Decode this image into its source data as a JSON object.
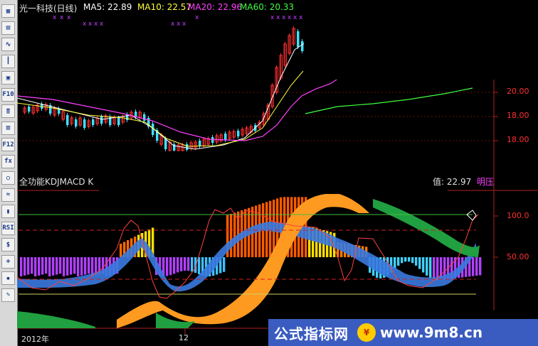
{
  "chart_data": {
    "type": "line",
    "price_panel": {
      "stock": "光一科技(日线)",
      "ma5_label": "MA5: 22.89",
      "ma10_label": "MA10: 22.57",
      "ma20_label": "MA20: 22.96",
      "ma60_label": "MA60: 20.33",
      "y_ticks": [
        "20.00",
        "18.00",
        "18.00"
      ],
      "colors": {
        "ma5": "#ffffff",
        "ma10": "#ffff40",
        "ma20": "#ff40ff",
        "ma60": "#40ff40",
        "up": "#ff3030",
        "down": "#40e0ff"
      }
    },
    "indicator_panel": {
      "name": "全功能KDJMACD K",
      "value_label": "值: 22.97",
      "tag": "明压",
      "y_ticks": [
        "100.0",
        "50.00"
      ]
    },
    "x_ticks": [
      "2012年",
      "12"
    ]
  },
  "toolbar": {
    "buttons": [
      {
        "icon": "grid-icon",
        "text": "▦"
      },
      {
        "icon": "table-icon",
        "text": "▤"
      },
      {
        "icon": "line-chart-icon",
        "text": "∿"
      },
      {
        "icon": "candle-icon",
        "text": "┃"
      },
      {
        "icon": "window-icon",
        "text": "▣"
      },
      {
        "icon": "f10-icon",
        "text": "F10"
      },
      {
        "icon": "stack-icon",
        "text": "≣"
      },
      {
        "icon": "page-icon",
        "text": "▥"
      },
      {
        "icon": "f12-icon",
        "text": "F12"
      },
      {
        "icon": "fx-icon",
        "text": "fx"
      },
      {
        "icon": "search-icon",
        "text": "○"
      },
      {
        "icon": "wave-icon",
        "text": "≈"
      },
      {
        "icon": "bars-icon",
        "text": "▮"
      },
      {
        "icon": "rsi-icon",
        "text": "RSI"
      },
      {
        "icon": "dollar-icon",
        "text": "$"
      },
      {
        "icon": "move-icon",
        "text": "✥"
      },
      {
        "icon": "book-icon",
        "text": "▪"
      },
      {
        "icon": "pencil-icon",
        "text": "✎"
      }
    ]
  },
  "watermark": {
    "left": "公式指标网",
    "logo": "¥",
    "right": "www.9m8.cn"
  }
}
